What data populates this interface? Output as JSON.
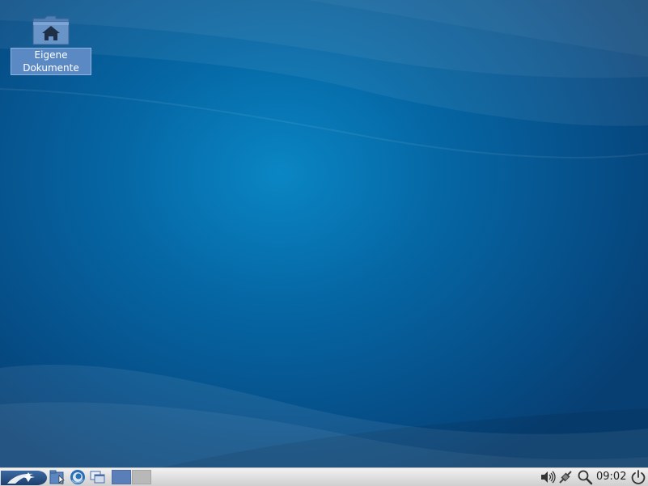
{
  "desktop": {
    "icons": [
      {
        "label": "Eigene\nDokumente",
        "icon": "home-folder-icon"
      }
    ]
  },
  "taskbar": {
    "start_icon": "lxde-logo-icon",
    "launchers": [
      {
        "icon": "file-manager-icon"
      },
      {
        "icon": "web-browser-icon"
      },
      {
        "icon": "window-switcher-icon"
      }
    ],
    "workspaces": [
      {
        "active": true
      },
      {
        "active": false
      }
    ],
    "tray": {
      "volume_icon": "speaker-icon",
      "network_icon": "network-plug-icon",
      "search_icon": "magnifier-icon",
      "power_icon": "power-icon"
    },
    "clock": "09:02"
  },
  "colors": {
    "desktop_center": "#0a86c4",
    "desktop_edge": "#073f73",
    "label_highlight": "#5b89c4",
    "taskbar": "#dcdcdc",
    "workspace_active": "#5a7fb8",
    "workspace_inactive": "#b8b8b8"
  }
}
